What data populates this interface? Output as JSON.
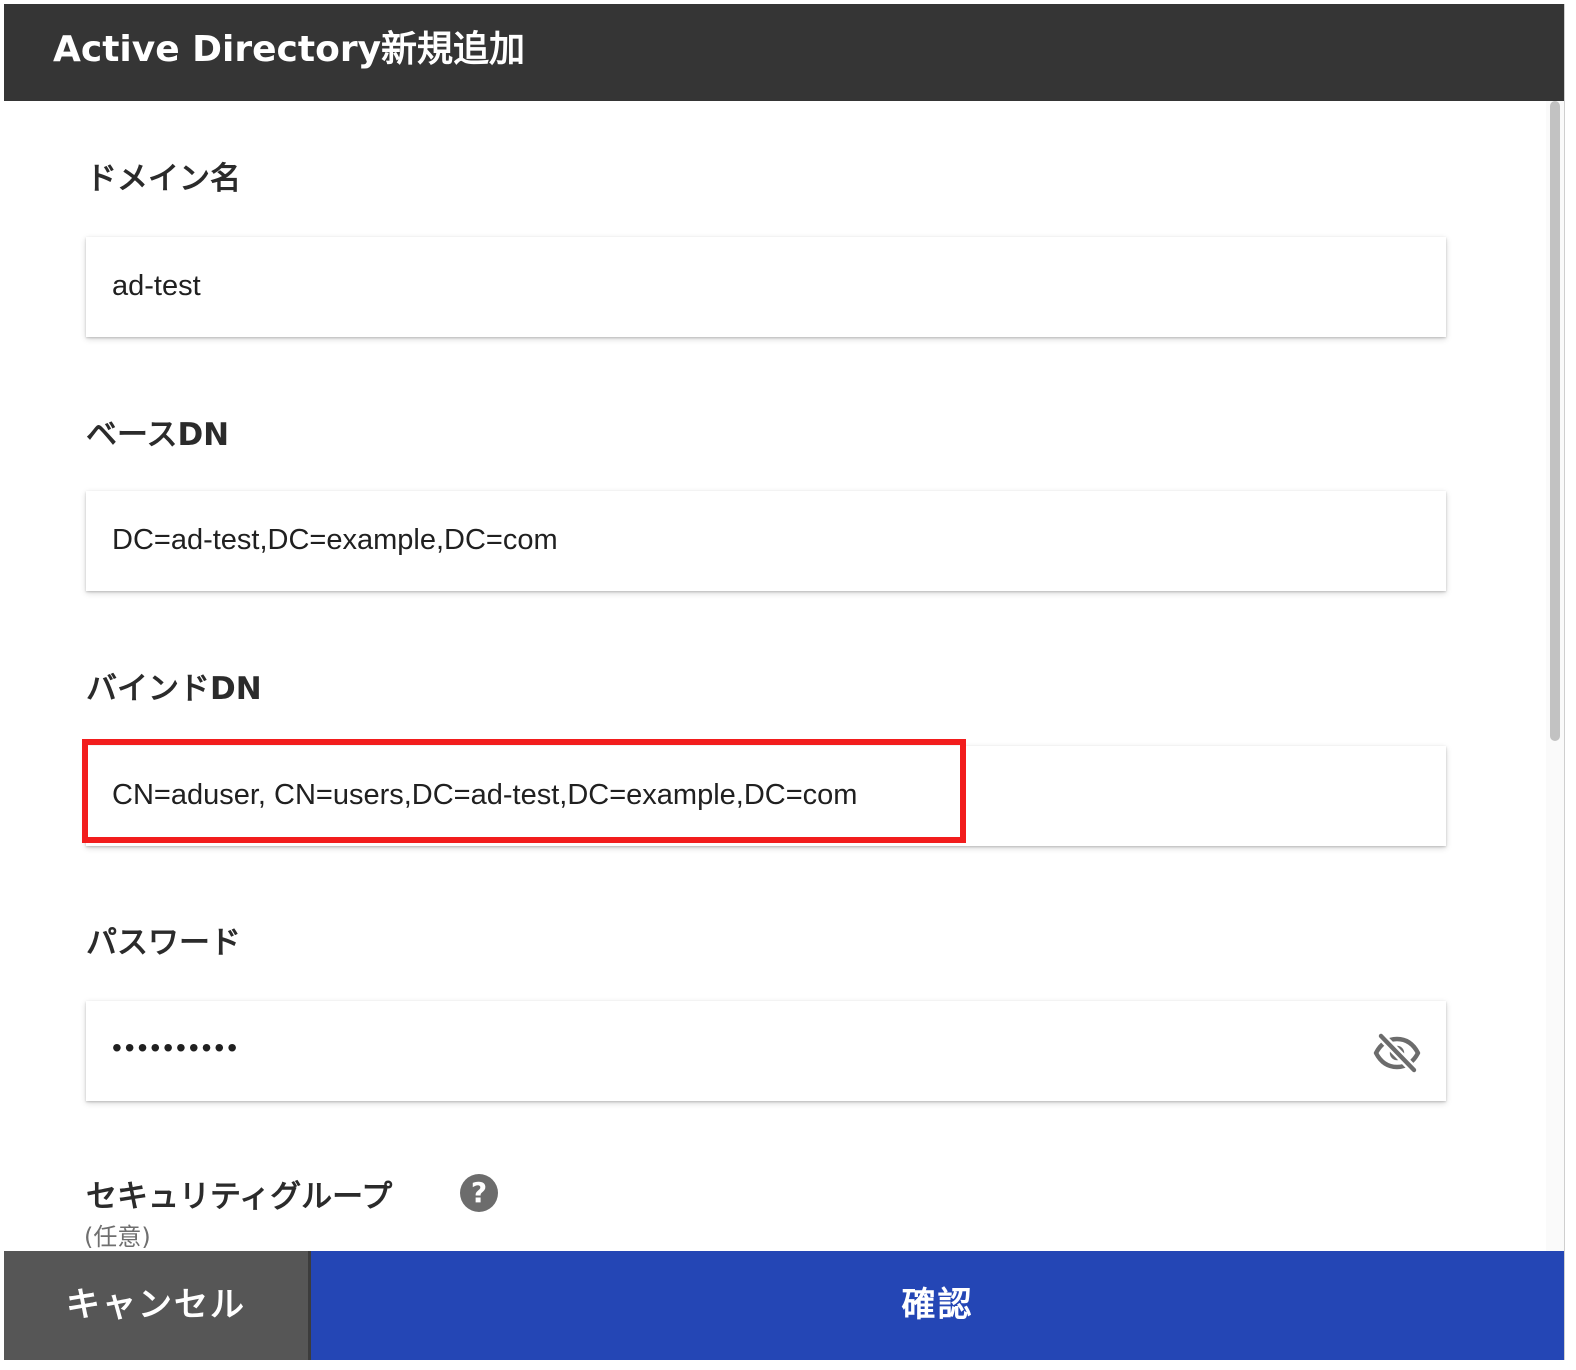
{
  "header": {
    "title": "Active Directory新規追加"
  },
  "fields": {
    "domain": {
      "label": "ドメイン名",
      "value": "ad-test"
    },
    "base_dn": {
      "label": "ベースDN",
      "value": "DC=ad-test,DC=example,DC=com"
    },
    "bind_dn": {
      "label": "バインドDN",
      "value": "CN=aduser, CN=users,DC=ad-test,DC=example,DC=com"
    },
    "password": {
      "label": "パスワード",
      "value": "••••••••••",
      "toggle_icon": "eye-off-icon"
    },
    "security_group": {
      "label": "セキュリティグループ",
      "help_icon": "?",
      "optional": "(任意)"
    }
  },
  "buttons": {
    "cancel": "キャンセル",
    "confirm": "確認"
  },
  "colors": {
    "header_bg": "#353535",
    "confirm_bg": "#2446b5",
    "cancel_bg": "#565656",
    "highlight": "#f21d1d"
  }
}
